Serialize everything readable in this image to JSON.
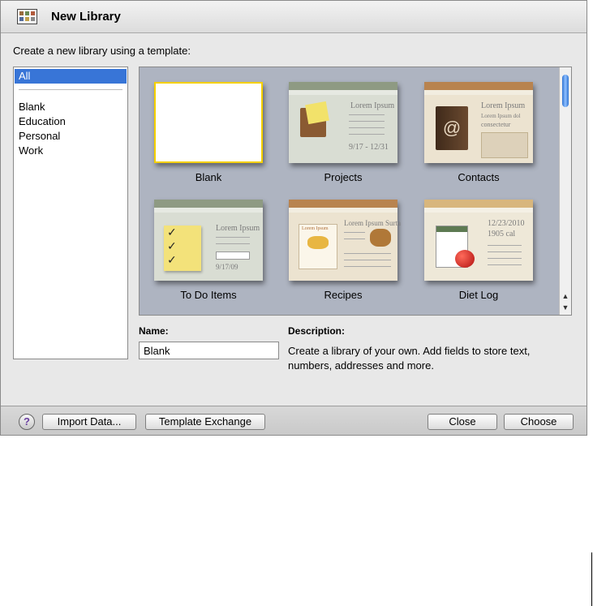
{
  "window": {
    "title": "New Library",
    "app_icon": "library-icon"
  },
  "instruction": "Create a new library using a template:",
  "categories": {
    "selected": "All",
    "items": [
      "Blank",
      "Education",
      "Personal",
      "Work"
    ]
  },
  "templates": [
    {
      "label": "Blank"
    },
    {
      "label": "Projects",
      "preview": {
        "heading": "Lorem Ipsum",
        "dates": "9/17 - 12/31"
      }
    },
    {
      "label": "Contacts",
      "preview": {
        "heading": "Lorem Ipsum",
        "sub": "Lorem Ipsum dol",
        "sub2": "consectetur"
      }
    },
    {
      "label": "To Do Items",
      "preview": {
        "heading": "Lorem Ipsum",
        "date": "9/17/09"
      }
    },
    {
      "label": "Recipes",
      "preview": {
        "heading": "Lorem Ipsum Surta",
        "card": "Lorem Ipsum"
      }
    },
    {
      "label": "Diet Log",
      "preview": {
        "date": "12/23/2010",
        "sub": "1905 cal"
      }
    }
  ],
  "name": {
    "label": "Name:",
    "value": "Blank"
  },
  "description": {
    "label": "Description:",
    "text": "Create a library of your own. Add fields to store text, numbers, addresses and more."
  },
  "buttons": {
    "help": "?",
    "import": "Import Data...",
    "template_exchange": "Template Exchange",
    "close": "Close",
    "choose": "Choose"
  },
  "scrollbar": {
    "up": "▲",
    "down": "▼"
  }
}
